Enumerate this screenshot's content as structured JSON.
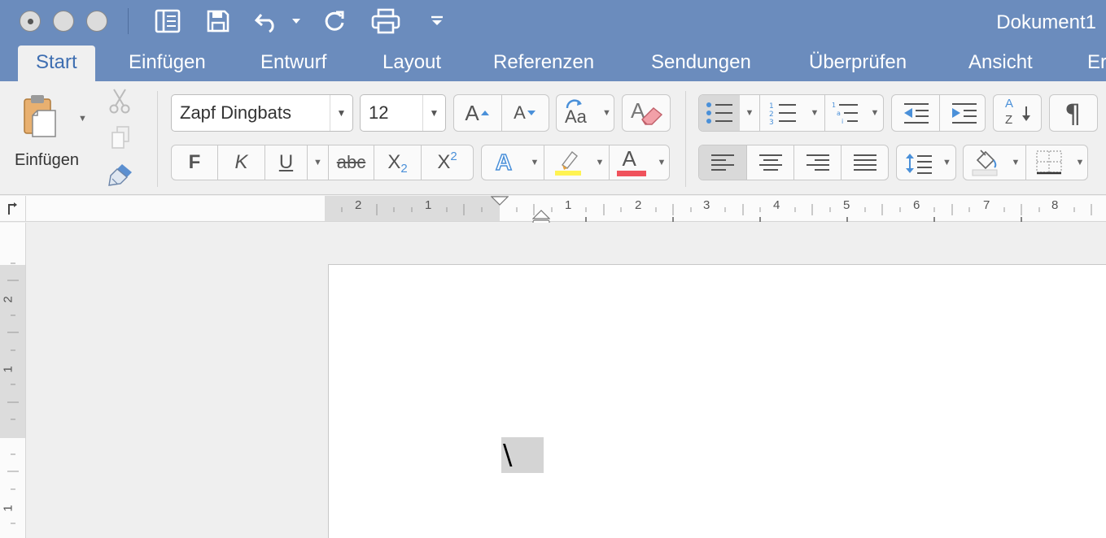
{
  "window": {
    "title": "Dokument1"
  },
  "tabs": [
    {
      "label": "Start",
      "active": true
    },
    {
      "label": "Einfügen"
    },
    {
      "label": "Entwurf"
    },
    {
      "label": "Layout"
    },
    {
      "label": "Referenzen"
    },
    {
      "label": "Sendungen"
    },
    {
      "label": "Überprüfen"
    },
    {
      "label": "Ansicht"
    },
    {
      "label": "Er"
    }
  ],
  "ribbon": {
    "clipboard": {
      "paste_label": "Einfügen"
    },
    "font": {
      "name": "Zapf Dingbats",
      "size": "12",
      "bold": "F",
      "italic": "K",
      "underline": "U",
      "strike": "abc",
      "subscript": "X",
      "sub_mark": "2",
      "superscript": "X",
      "sup_mark": "2",
      "grow": "A",
      "shrink": "A",
      "case": "Aa",
      "clear": "A",
      "effects": "A",
      "color": "A"
    },
    "paragraph": {
      "pilcrow": "¶",
      "sort_a": "A",
      "sort_z": "Z"
    }
  },
  "ruler": {
    "h_labels": [
      "2",
      "1",
      "1",
      "2",
      "3",
      "4",
      "5",
      "6",
      "7",
      "8"
    ],
    "v_labels": [
      "2",
      "1",
      "1"
    ]
  },
  "document": {
    "selected_text": "\\"
  },
  "colors": {
    "titlebar": "#6b8cbd",
    "accent": "#3e6eb1",
    "highlight": "#fff352",
    "font_color": "#f0525c"
  }
}
